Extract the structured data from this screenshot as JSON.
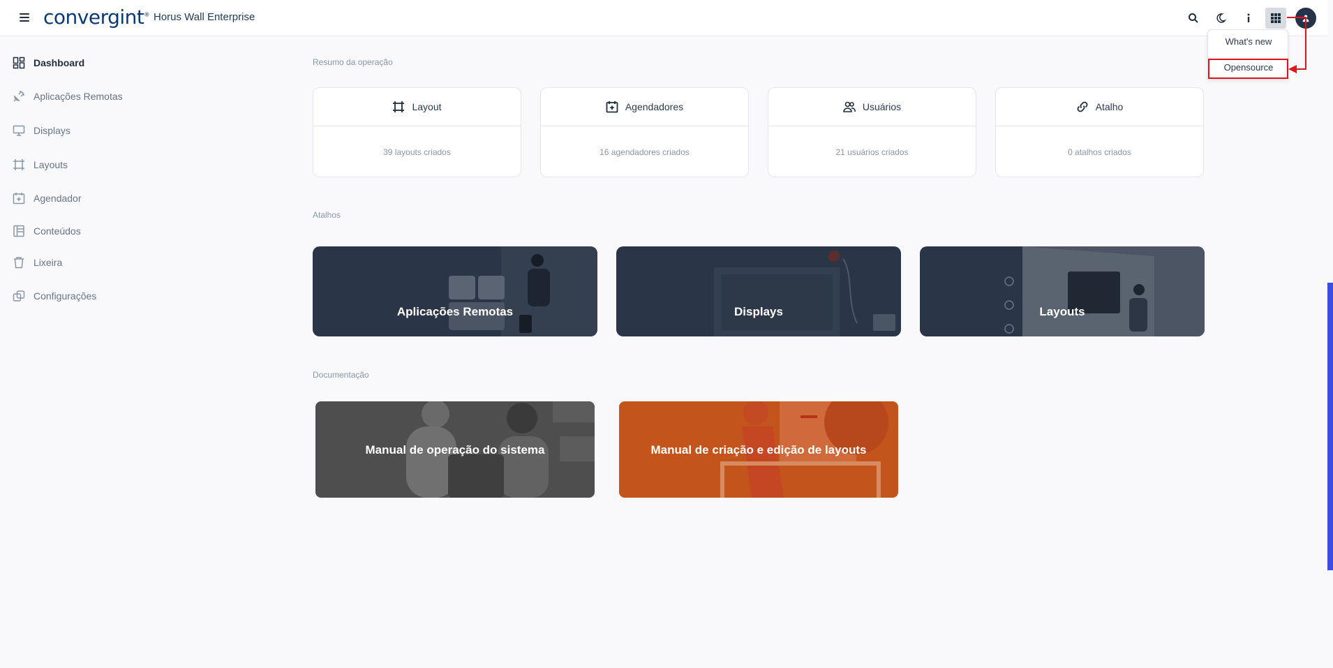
{
  "header": {
    "logo_text": "convergint",
    "logo_mark": "®",
    "app_title": "Horus Wall Enterprise",
    "icons": [
      "menu-icon",
      "search-icon",
      "moon-icon",
      "info-icon",
      "apps-grid-icon",
      "user-icon"
    ],
    "avatar_initial": "A"
  },
  "dropdown": {
    "items": [
      "What's new",
      "Opensource"
    ],
    "highlight_color": "#e0141e"
  },
  "sidebar": {
    "items": [
      {
        "label": "Dashboard",
        "icon": "dashboard-icon",
        "active": true
      },
      {
        "label": "Aplicações Remotas",
        "icon": "satellite-icon",
        "active": false
      },
      {
        "label": "Displays",
        "icon": "monitor-icon",
        "active": false
      },
      {
        "label": "Layouts",
        "icon": "crop-icon",
        "active": false
      },
      {
        "label": "Agendador",
        "icon": "calendar-plus-icon",
        "active": false
      },
      {
        "label": "Conteúdos",
        "icon": "layout-panel-icon",
        "active": false
      },
      {
        "label": "Lixeira",
        "icon": "trash-icon",
        "active": false
      },
      {
        "label": "Configurações",
        "icon": "settings-icon",
        "active": false
      }
    ]
  },
  "summary": {
    "title": "Resumo da operação",
    "cards": [
      {
        "title": "Layout",
        "count_text": "39 layouts criados",
        "icon": "crop-icon"
      },
      {
        "title": "Agendadores",
        "count_text": "16 agendadores criados",
        "icon": "calendar-plus-icon"
      },
      {
        "title": "Usuários",
        "count_text": "21 usuários criados",
        "icon": "users-icon"
      },
      {
        "title": "Atalho",
        "count_text": "0 atalhos criados",
        "icon": "link-icon"
      }
    ]
  },
  "shortcuts": {
    "title": "Atalhos",
    "items": [
      {
        "label": "Aplicações Remotas"
      },
      {
        "label": "Displays"
      },
      {
        "label": "Layouts"
      }
    ]
  },
  "documentation": {
    "title": "Documentação",
    "items": [
      {
        "label": "Manual de operação do sistema",
        "color": "#4e4e4e"
      },
      {
        "label": "Manual de criação e edição de layouts",
        "color": "#c2541c"
      }
    ]
  },
  "colors": {
    "accent": "#3b4ee0",
    "header_text": "#1f3a5a",
    "card_dark": "#2a3647"
  }
}
